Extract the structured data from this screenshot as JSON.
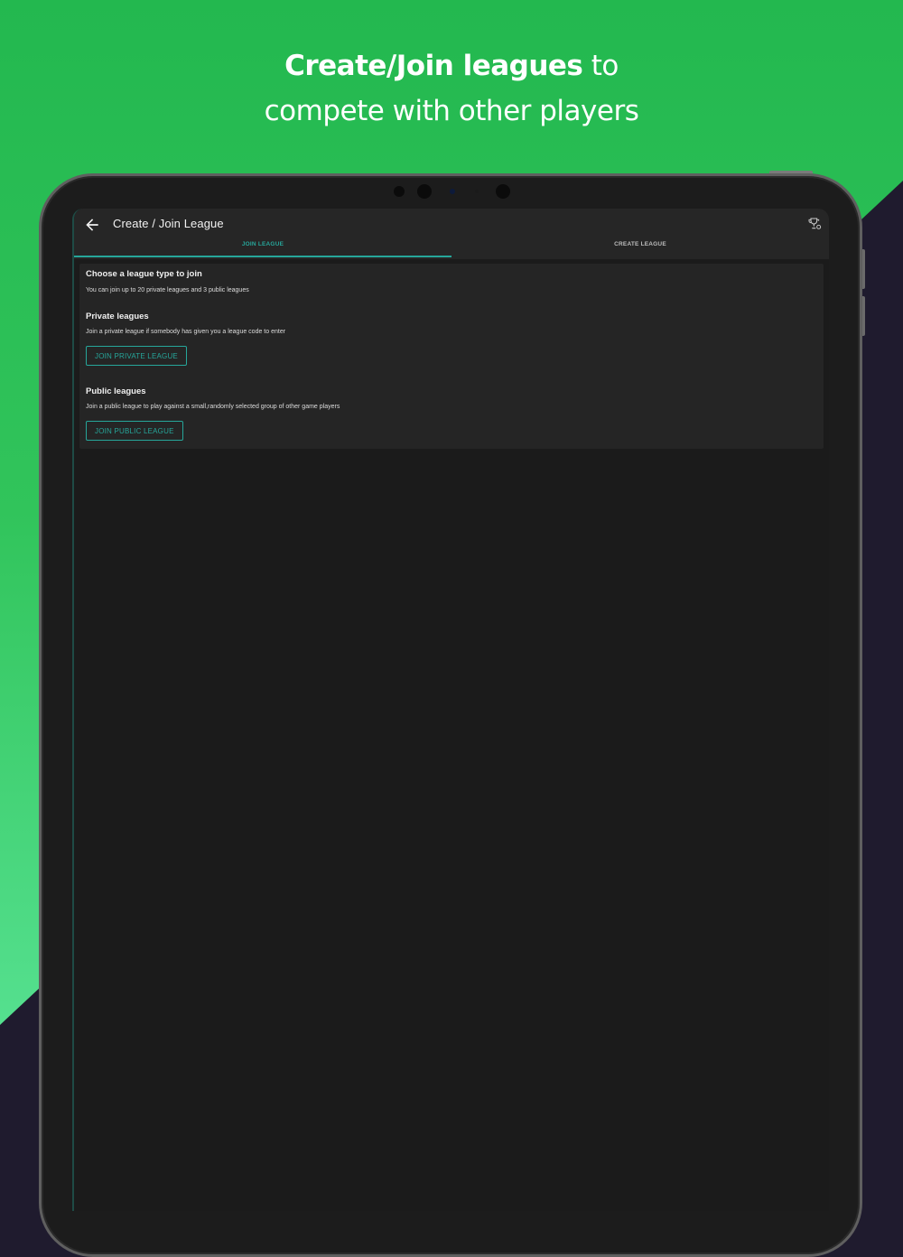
{
  "promo": {
    "bold": "Create/Join leagues",
    "rest": " to",
    "line2": "compete with other players"
  },
  "colors": {
    "background_green": "#23b84f",
    "background_dark": "#1f1b2e",
    "accent": "#26a69a",
    "screen_bg": "#1b1b1b",
    "card_bg": "#252525"
  },
  "appbar": {
    "title": "Create / Join League",
    "back_icon": "arrow-left-icon",
    "trophy_icon": "trophy-icon"
  },
  "tabs": [
    {
      "label": "JOIN LEAGUE",
      "selected": true
    },
    {
      "label": "CREATE LEAGUE",
      "selected": false
    }
  ],
  "join": {
    "heading": "Choose a league type to join",
    "subheading": "You can join up to 20 private leagues and 3 public leagues",
    "private": {
      "title": "Private leagues",
      "description": "Join a private league if somebody has given you a league code to enter",
      "button": "JOIN PRIVATE LEAGUE"
    },
    "public": {
      "title": "Public leagues",
      "description": "Join a public league to play against a small,randomly selected group of other game players",
      "button": "JOIN PUBLIC LEAGUE"
    }
  }
}
